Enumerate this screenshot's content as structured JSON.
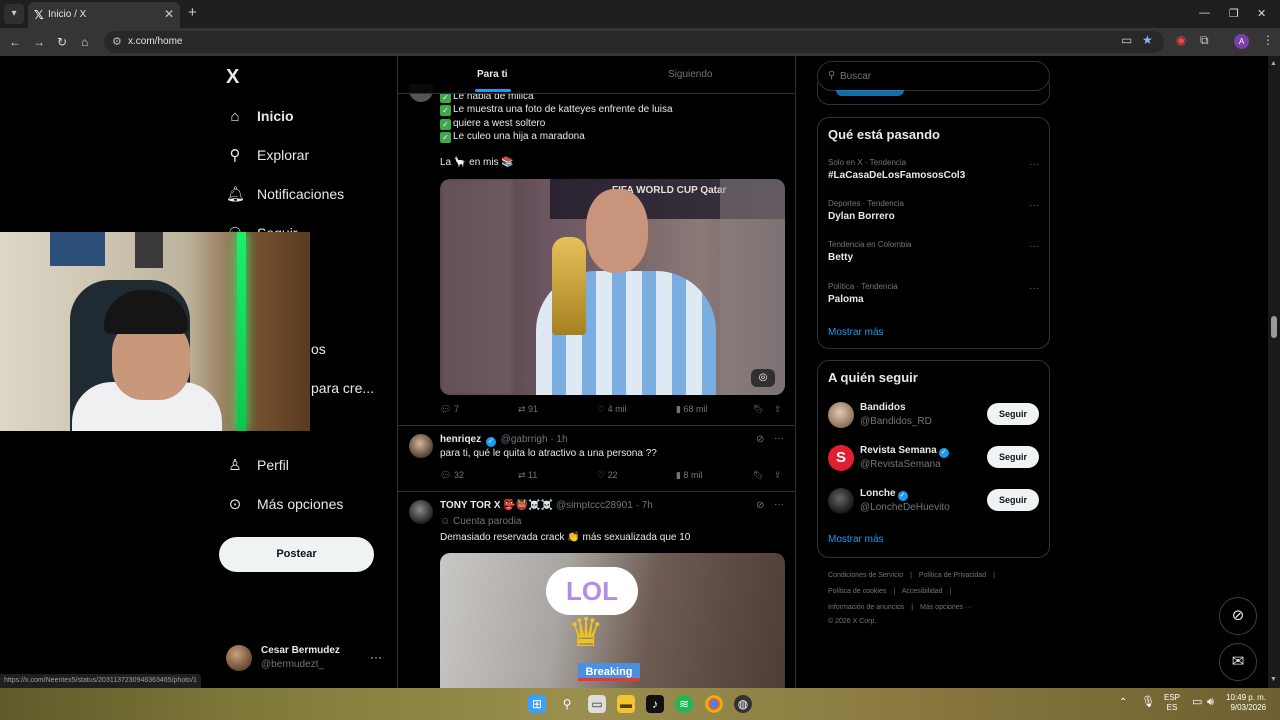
{
  "browser": {
    "tab_title": "Inicio / X",
    "url": "x.com/home",
    "status_url": "https://x.com/Neentex5/status/2031137230946363465/photo/1"
  },
  "sidebar": {
    "logo": "X",
    "items": [
      {
        "label": "Inicio",
        "icon": "home-icon"
      },
      {
        "label": "Explorar",
        "icon": "search-icon"
      },
      {
        "label": "Notificaciones",
        "icon": "bell-icon"
      },
      {
        "label": "Seguir",
        "icon": "add-user-icon"
      },
      {
        "label": "Perfil",
        "icon": "person-icon"
      },
      {
        "label": "Más opciones",
        "icon": "more-circle-icon"
      }
    ],
    "partial_labels": [
      "os",
      "para cre..."
    ],
    "post_label": "Postear",
    "account": {
      "name": "Cesar Bermudez",
      "handle": "@bermudezt_"
    }
  },
  "feed": {
    "tabs": [
      {
        "label": "Para ti",
        "active": true
      },
      {
        "label": "Siguiendo",
        "active": false
      }
    ],
    "tweet1": {
      "lines": [
        "Le habla de milica",
        "Le muestra una foto de katteyes enfrente de luisa",
        "quiere a west soltero",
        "Le culeo una hija a maradona"
      ],
      "closing": "La 🦙 en mis 📚",
      "image_banner": "FIFA WORLD CUP Qatar",
      "stats": {
        "replies": "7",
        "reposts": "91",
        "likes": "4 mil",
        "views": "68 mil"
      }
    },
    "tweet2": {
      "name": "henriqez",
      "handle": "@gabrrigh",
      "time": "· 1h",
      "text": "para ti, qué le quita lo atractivo a una persona ??",
      "stats": {
        "replies": "32",
        "reposts": "11",
        "likes": "22",
        "views": "8 mil"
      }
    },
    "tweet3": {
      "name": "TONY TOR X 👺👹☠️☠️",
      "handle": "@simptccc28901",
      "time": "· 7h",
      "label": "Cuenta parodia",
      "text": "Demasiado reservada crack 👏 más sexualizada que 10",
      "overlay_big": "LOL",
      "overlay_tag": "Breaking"
    }
  },
  "right": {
    "search_placeholder": "Buscar",
    "trends_title": "Qué está pasando",
    "trends": [
      {
        "category": "Solo en X · Tendencia",
        "name": "#LaCasaDeLosFamososCol3"
      },
      {
        "category": "Deportes · Tendencia",
        "name": "Dylan Borrero"
      },
      {
        "category": "Tendencia en Colombia",
        "name": "Betty"
      },
      {
        "category": "Política · Tendencia",
        "name": "Paloma"
      }
    ],
    "show_more": "Mostrar más",
    "follow_title": "A quién seguir",
    "who_to_follow": [
      {
        "name": "Bandidos",
        "handle": "@Bandidos_RD",
        "verified": false,
        "avatar_color": "#d9c2a8"
      },
      {
        "name": "Revista Semana",
        "handle": "@RevistaSemana",
        "verified": true,
        "avatar_color": "#e0202e"
      },
      {
        "name": "Lonche",
        "handle": "@LoncheDeHuevito",
        "verified": true,
        "avatar_color": "#3a3a3a"
      }
    ],
    "follow_label": "Seguir",
    "footer_rows": [
      [
        "Condiciones de Servicio",
        "|",
        "Política de Privacidad",
        "|"
      ],
      [
        "Política de cookies",
        "|",
        "Accesibilidad",
        "|"
      ],
      [
        "Información de anuncios",
        "|",
        "Más opciones ···"
      ],
      [
        "© 2026 X Corp."
      ]
    ]
  },
  "taskbar": {
    "lang": "ESP",
    "lang2": "ES",
    "time": "10:49 p. m.",
    "date": "9/03/2026"
  }
}
